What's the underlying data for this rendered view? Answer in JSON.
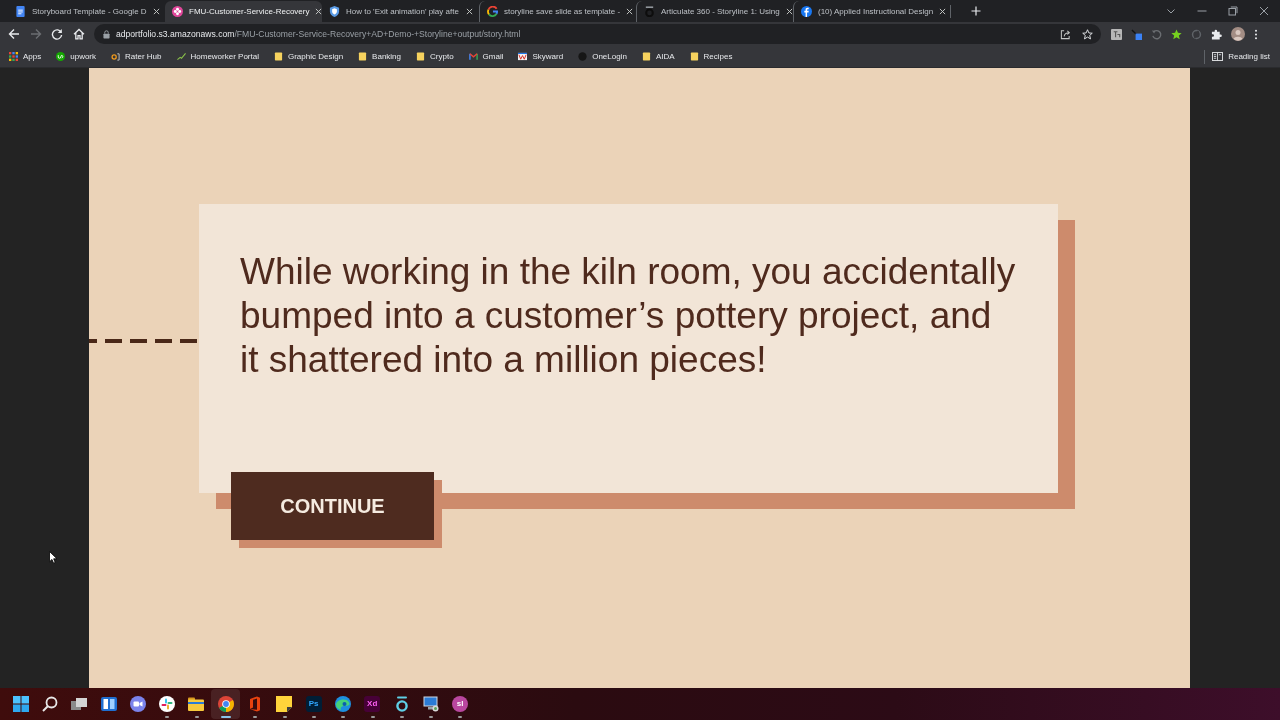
{
  "tabs": [
    {
      "title": "Storyboard Template - Google D",
      "kind": "document",
      "selected": false
    },
    {
      "title": "FMU-Customer-Service-Recovery",
      "kind": "flower",
      "selected": true
    },
    {
      "title": "How to 'Exit animation' play afte",
      "kind": "shield",
      "selected": false
    },
    {
      "title": "storyline save slide as template -",
      "kind": "ring",
      "selected": false
    },
    {
      "title": "Articulate 360 - Storyline 1: Using",
      "kind": "cup",
      "selected": false
    },
    {
      "title": "(10) Applied Instructional Design",
      "kind": "circle-f",
      "selected": false
    }
  ],
  "navigation": {
    "forward_disabled": true
  },
  "address_bar": {
    "host": "adportfolio.s3.amazonaws.com",
    "path": "/FMU-Customer-Service-Recovery+AD+Demo-+Storyline+output/story.html"
  },
  "bookmarks": [
    {
      "label": "Apps",
      "kind": "grid"
    },
    {
      "label": "upwork",
      "kind": "round-green"
    },
    {
      "label": "Rater Hub",
      "kind": "bracket"
    },
    {
      "label": "Homeworker Portal",
      "kind": "zigzag"
    },
    {
      "label": "Graphic Design",
      "kind": "folder"
    },
    {
      "label": "Banking",
      "kind": "folder"
    },
    {
      "label": "Crypto",
      "kind": "folder"
    },
    {
      "label": "Gmail",
      "kind": "envelope"
    },
    {
      "label": "Skyward",
      "kind": "striped"
    },
    {
      "label": "OneLogin",
      "kind": "dot"
    },
    {
      "label": "AIDA",
      "kind": "folder"
    },
    {
      "label": "Recipes",
      "kind": "folder"
    }
  ],
  "reading_list": "Reading list",
  "slide": {
    "message": "While working in the kiln room, you accidentally\nbumped into a customer’s pottery project, and\nit shattered into a million pieces!",
    "button": "CONTINUE"
  },
  "taskbar": [
    {
      "kind": "start",
      "running": false,
      "selected": false
    },
    {
      "kind": "search",
      "running": false,
      "selected": false
    },
    {
      "kind": "task-view",
      "running": false,
      "selected": false
    },
    {
      "kind": "widgets",
      "running": false,
      "selected": false
    },
    {
      "kind": "chat",
      "running": false,
      "selected": false
    },
    {
      "kind": "pinwheel",
      "running": true,
      "selected": false
    },
    {
      "kind": "folder",
      "running": true,
      "selected": false
    },
    {
      "kind": "round-logo",
      "running": true,
      "selected": true
    },
    {
      "kind": "office",
      "running": true,
      "selected": false
    },
    {
      "kind": "sticky-note",
      "running": true,
      "selected": false
    },
    {
      "kind": "ps-tile",
      "glyph": "Ps",
      "running": true,
      "selected": false
    },
    {
      "kind": "swirl",
      "running": true,
      "selected": false
    },
    {
      "kind": "xd-tile",
      "glyph": "Xd",
      "running": true,
      "selected": false
    },
    {
      "kind": "cup",
      "running": true,
      "selected": false
    },
    {
      "kind": "monitor",
      "running": true,
      "selected": false
    },
    {
      "kind": "sl-disc",
      "glyph": "sl",
      "running": true,
      "selected": false
    }
  ]
}
